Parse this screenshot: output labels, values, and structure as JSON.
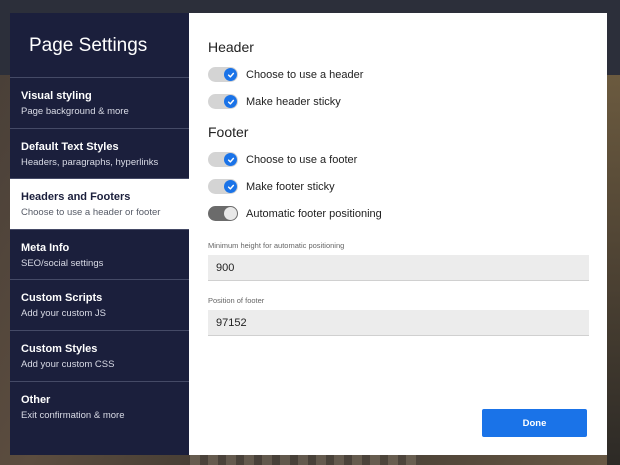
{
  "sidebar": {
    "title": "Page Settings",
    "items": [
      {
        "label": "Visual styling",
        "sub": "Page background & more"
      },
      {
        "label": "Default Text Styles",
        "sub": "Headers, paragraphs, hyperlinks"
      },
      {
        "label": "Headers and Footers",
        "sub": "Choose to use a header or footer"
      },
      {
        "label": "Meta Info",
        "sub": "SEO/social settings"
      },
      {
        "label": "Custom Scripts",
        "sub": "Add your custom JS"
      },
      {
        "label": "Custom Styles",
        "sub": "Add your custom CSS"
      },
      {
        "label": "Other",
        "sub": "Exit confirmation & more"
      }
    ],
    "active_index": 2
  },
  "header_section": {
    "title": "Header",
    "toggles": [
      {
        "label": "Choose to use a header",
        "checked": true
      },
      {
        "label": "Make header sticky",
        "checked": true
      }
    ]
  },
  "footer_section": {
    "title": "Footer",
    "toggles": [
      {
        "label": "Choose to use a footer",
        "checked": true
      },
      {
        "label": "Make footer sticky",
        "checked": true
      },
      {
        "label": "Automatic footer positioning",
        "checked": false
      }
    ]
  },
  "fields": {
    "min_height": {
      "label": "Minimum height for automatic positioning",
      "value": "900"
    },
    "position": {
      "label": "Position of footer",
      "value": "97152"
    }
  },
  "done_label": "Done",
  "colors": {
    "accent": "#1a73e8",
    "sidebar_bg": "#1b1f3c"
  }
}
